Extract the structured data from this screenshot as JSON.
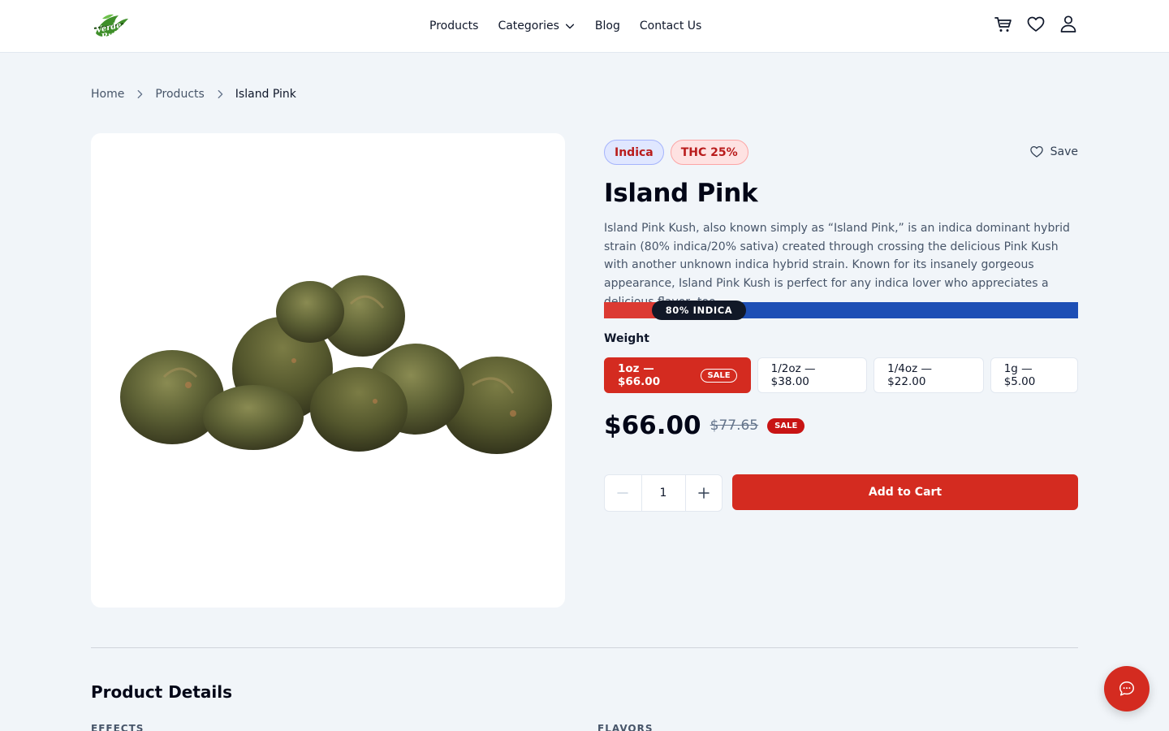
{
  "header": {
    "logo_text": "Verde Ruta",
    "nav": [
      "Products",
      "Categories",
      "Blog",
      "Contact Us"
    ],
    "icons": [
      "cart-icon",
      "heart-icon",
      "user-icon"
    ]
  },
  "breadcrumb": {
    "home": "Home",
    "products": "Products",
    "current": "Island Pink"
  },
  "product": {
    "tags": {
      "type": "Indica",
      "thc": "THC 25%"
    },
    "save_label": "Save",
    "name": "Island Pink",
    "description": "Island Pink Kush, also known simply as “Island Pink,” is an indica dominant hybrid strain (80% indica/20% sativa) created through crossing the delicious Pink Kush with another unknown indica hybrid strain. Known for its insanely gorgeous appearance, Island Pink Kush is perfect for any indica lover who appreciates a delicious flavor, too.",
    "ratio_label": "80% INDICA",
    "weight_label": "Weight",
    "weights": [
      {
        "label": "1oz — $66.00",
        "sale": "SALE"
      },
      {
        "label": "1/2oz — $38.00"
      },
      {
        "label": "1/4oz — $22.00"
      },
      {
        "label": "1g — $5.00"
      }
    ],
    "price": "$66.00",
    "old_price": "$77.65",
    "sale_badge": "SALE",
    "quantity": "1",
    "add_to_cart": "Add to Cart"
  },
  "details": {
    "title": "Product Details",
    "effects": "EFFECTS",
    "flavors": "FLAVORS"
  },
  "colors": {
    "accent": "#d42b20",
    "indica_bar": "#1e4fb5",
    "pill": "#111827"
  }
}
